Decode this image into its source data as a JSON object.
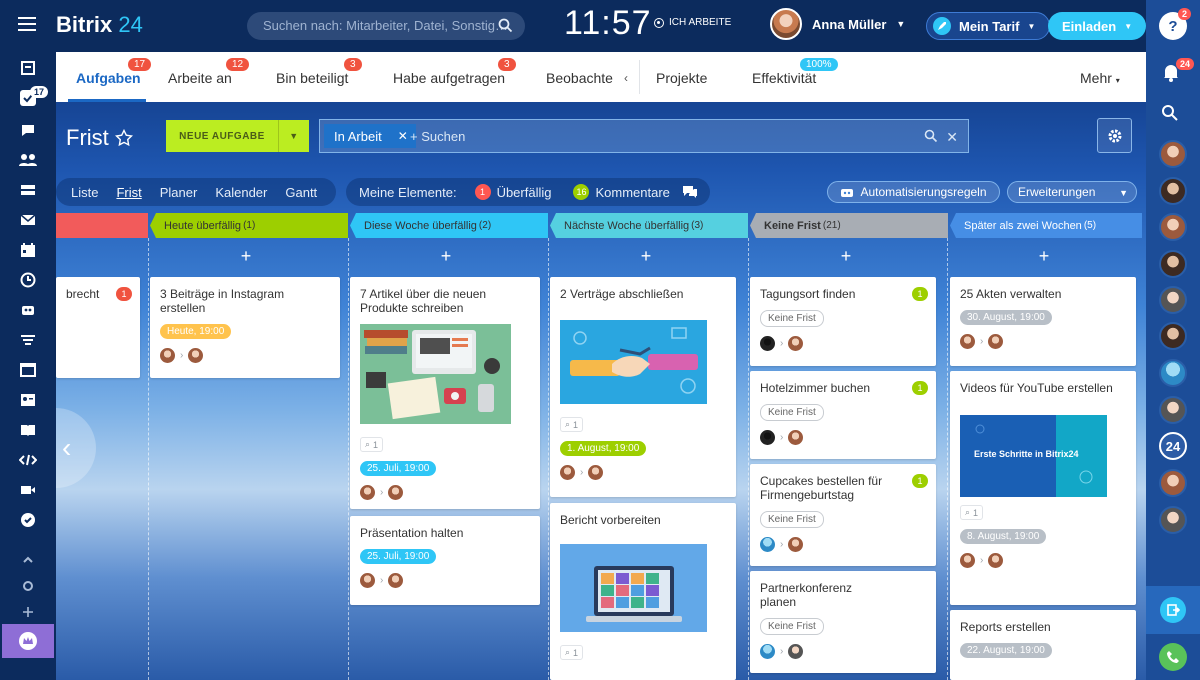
{
  "app": {
    "logo": "Bitrix",
    "logo_num": "24"
  },
  "header": {
    "search_placeholder": "Suchen nach: Mitarbeiter, Datei, Sonstig…",
    "clock": "11:57",
    "status": "ICH ARBEITE",
    "user_name": "Anna Müller",
    "tarif_label": "Mein Tarif",
    "invite_label": "Einladen"
  },
  "leftbar": {
    "tasks_badge": "17"
  },
  "rightbar": {
    "help_badge": "2",
    "notify_badge": "24",
    "b24_label": "24"
  },
  "tabs": [
    {
      "label": "Aufgaben",
      "badge": "17"
    },
    {
      "label": "Arbeite an",
      "badge": "12"
    },
    {
      "label": "Bin beteiligt",
      "badge": "3"
    },
    {
      "label": "Habe aufgetragen",
      "badge": "3"
    },
    {
      "label": "Beobachte",
      "badge": ""
    },
    {
      "label": "Projekte",
      "badge": ""
    },
    {
      "label": "Effektivität",
      "badge": "100%"
    },
    {
      "label": "Mehr",
      "badge": ""
    }
  ],
  "toolbar": {
    "title": "Frist",
    "new_task": "NEUE AUFGABE",
    "filter_chip": "In Arbeit",
    "filter_placeholder": "+ Suchen"
  },
  "views": [
    "Liste",
    "Frist",
    "Planer",
    "Kalender",
    "Gantt"
  ],
  "mine": {
    "label": "Meine Elemente:",
    "overdue_count": "1",
    "overdue_label": "Überfällig",
    "comments_count": "16",
    "comments_label": "Kommentare"
  },
  "automation_label": "Automatisierungsregeln",
  "extensions_label": "Erweiterungen",
  "columns": [
    {
      "name": "",
      "count": "",
      "color": "#f25b5b",
      "text": "#fff"
    },
    {
      "name": "Heute überfällig",
      "count": "(1)",
      "color": "#9dcf00",
      "text": "#333"
    },
    {
      "name": "Diese Woche überfällig",
      "count": "(2)",
      "color": "#2fc6f6",
      "text": "#333"
    },
    {
      "name": "Nächste Woche überfällig",
      "count": "(3)",
      "color": "#55d0e0",
      "text": "#333"
    },
    {
      "name": "Keine Frist",
      "count": "(21)",
      "color": "#a8adb4",
      "text": "#333"
    },
    {
      "name": "Später als zwei Wochen",
      "count": "(5)",
      "color": "#468ee5",
      "text": "#fff"
    }
  ],
  "cards": {
    "c0": {
      "title": "brecht",
      "badge": "1"
    },
    "c1": {
      "title": "3 Beiträge in Instagram erstellen",
      "deadline": "Heute, 19:00"
    },
    "c2": {
      "title": "7 Artikel über die neuen Produkte schreiben",
      "clip": "1",
      "deadline": "25. Juli, 19:00"
    },
    "c3": {
      "title": "Präsentation halten",
      "deadline": "25. Juli, 19:00"
    },
    "c4": {
      "title": "2 Verträge abschließen",
      "clip": "1",
      "deadline": "1. August, 19:00"
    },
    "c5": {
      "title": "Bericht vorbereiten",
      "clip": "1"
    },
    "c6": {
      "title": "Tagungsort finden",
      "badge": "1",
      "deadline": "Keine Frist"
    },
    "c7": {
      "title": "Hotelzimmer buchen",
      "badge": "1",
      "deadline": "Keine Frist"
    },
    "c8": {
      "title": "Cupcakes bestellen für Firmengeburtstag",
      "badge": "1",
      "deadline": "Keine Frist"
    },
    "c9": {
      "title": "Partnerkonferenz planen",
      "deadline": "Keine Frist"
    },
    "c10": {
      "title": "25 Akten verwalten",
      "deadline": "30. August, 19:00"
    },
    "c11": {
      "title": "Videos für YouTube erstellen",
      "image_text": "Erste Schritte in Bitrix24",
      "clip": "1",
      "deadline": "8. August, 19:00"
    },
    "c12": {
      "title": "Reports erstellen",
      "deadline": "22. August, 19:00"
    }
  }
}
